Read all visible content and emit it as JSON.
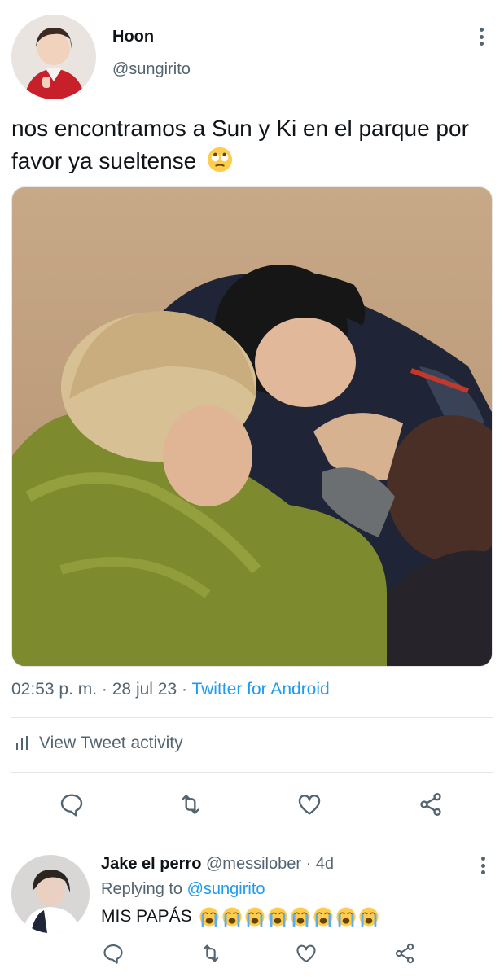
{
  "tweet": {
    "author_name": "Hoon",
    "author_handle": "@sungirito",
    "text": "nos encontramos a Sun y Ki en el parque por favor ya sueltense",
    "emoji": "face-with-rolling-eyes-emoji",
    "media_description_icon": "photo-two-people-hugging",
    "time": "02:53 p. m.",
    "date": "28 jul 23",
    "source": "Twitter for Android",
    "activity_label": "View Tweet activity",
    "actions": [
      "reply-icon",
      "retweet-icon",
      "like-icon",
      "share-icon"
    ]
  },
  "reply": {
    "author_name": "Jake el perro",
    "author_handle": "@messilober",
    "age": "4d",
    "replying_prefix": "Replying to",
    "replying_to": "@sungirito",
    "text": "MIS PAPÁS",
    "emoji": "loudly-crying-face-emoji",
    "emoji_count": 8
  },
  "colors": {
    "text_primary": "#0f1419",
    "text_secondary": "#536471",
    "link": "#1d9bf0",
    "divider": "#e1e6ea"
  },
  "meta_separator": "·"
}
